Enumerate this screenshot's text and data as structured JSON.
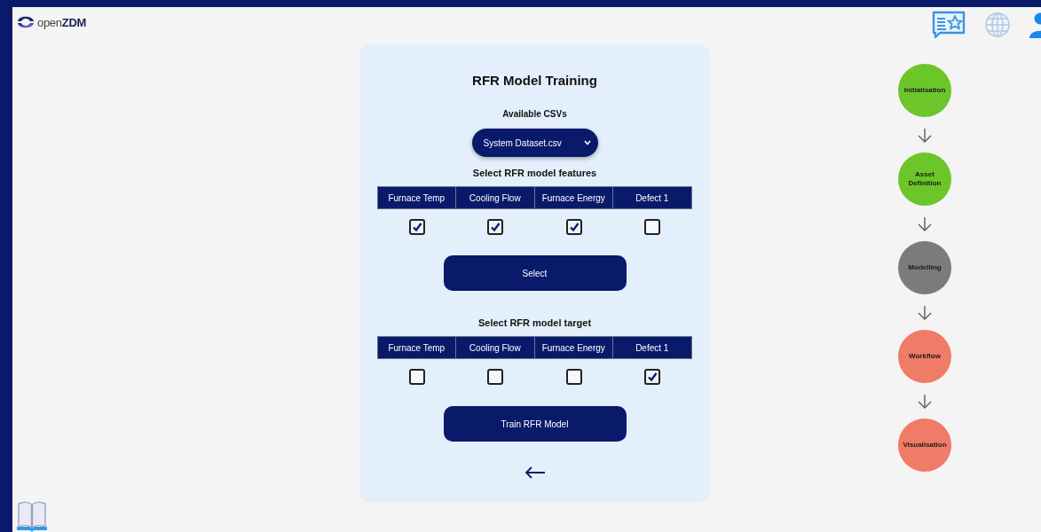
{
  "logo": {
    "text": "open**ZDM**"
  },
  "card": {
    "title": "RFR Model Training",
    "csv_label": "Available CSVs",
    "csv_select": {
      "value": "System Dataset.csv"
    },
    "sections": [
      {
        "heading": "Select RFR model features",
        "button": "Select",
        "columns": [
          {
            "label": "Furnace Temp",
            "checked": true
          },
          {
            "label": "Cooling Flow",
            "checked": true
          },
          {
            "label": "Furnace Energy",
            "checked": true
          },
          {
            "label": "Defect 1",
            "checked": false
          }
        ]
      },
      {
        "heading": "Select RFR model target",
        "button": "Train RFR Model",
        "columns": [
          {
            "label": "Furnace Temp",
            "checked": false
          },
          {
            "label": "Cooling Flow",
            "checked": false
          },
          {
            "label": "Furnace Energy",
            "checked": false
          },
          {
            "label": "Defect 1",
            "checked": true
          }
        ]
      }
    ]
  },
  "steps": [
    {
      "label": "Initialisation",
      "color": "#6cc62a"
    },
    {
      "label": "Asset Definition",
      "color": "#6cc62a"
    },
    {
      "label": "Modelling",
      "color": "#7b7b7b"
    },
    {
      "label": "Workflow",
      "color": "#f07b66"
    },
    {
      "label": "Visualisation",
      "color": "#f07b66"
    }
  ]
}
